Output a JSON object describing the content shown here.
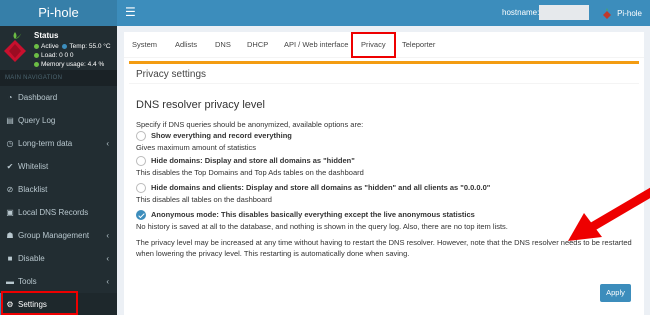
{
  "app": {
    "title": "Pi-hole",
    "menu_icon": "hamburger-icon"
  },
  "topbar": {
    "hostname_label": "hostname:",
    "user_label": "Pi-hole"
  },
  "sidebar": {
    "status": {
      "title": "Status",
      "active": "Active",
      "temp": "Temp: 55.0 °C",
      "load": "Load:  0  0  0",
      "memory": "Memory usage:  4.4 %"
    },
    "nav_header": "MAIN NAVIGATION",
    "items": [
      {
        "label": "Dashboard",
        "icon": "dashboard-icon",
        "glyph": "◔"
      },
      {
        "label": "Query Log",
        "icon": "file-icon",
        "glyph": "▤"
      },
      {
        "label": "Long-term data",
        "icon": "history-icon",
        "glyph": "◷",
        "chevron": "‹"
      },
      {
        "label": "Whitelist",
        "icon": "check-circle-icon",
        "glyph": "✔"
      },
      {
        "label": "Blacklist",
        "icon": "ban-icon",
        "glyph": "⊘"
      },
      {
        "label": "Local DNS Records",
        "icon": "address-book-icon",
        "glyph": "▣"
      },
      {
        "label": "Group Management",
        "icon": "users-icon",
        "glyph": "☗",
        "chevron": "‹"
      },
      {
        "label": "Disable",
        "icon": "stop-icon",
        "glyph": "■",
        "chevron": "‹"
      },
      {
        "label": "Tools",
        "icon": "folder-icon",
        "glyph": "▬",
        "chevron": "‹"
      },
      {
        "label": "Settings",
        "icon": "gears-icon",
        "glyph": "⚙"
      }
    ]
  },
  "tabs": [
    "System",
    "Adlists",
    "DNS",
    "DHCP",
    "API / Web interface",
    "Privacy",
    "Teleporter"
  ],
  "privacy": {
    "title": "Privacy settings",
    "heading": "DNS resolver privacy level",
    "intro": "Specify if DNS queries should be anonymized, available options are:",
    "options": [
      {
        "label": "Show everything and record everything",
        "desc": "Gives maximum amount of statistics"
      },
      {
        "label": "Hide domains: Display and store all domains as \"hidden\"",
        "desc": "This disables the Top Domains and Top Ads tables on the dashboard"
      },
      {
        "label": "Hide domains and clients: Display and store all domains as \"hidden\" and all clients as \"0.0.0.0\"",
        "desc": "This disables all tables on the dashboard"
      },
      {
        "label": "Anonymous mode: This disables basically everything except the live anonymous statistics",
        "desc": "No history is saved at all to the database, and nothing is shown in the query log. Also, there are no top item lists."
      }
    ],
    "selected_index": 3,
    "note": "The privacy level may be increased at any time without having to restart the DNS resolver. However, note that the DNS resolver needs to be restarted when lowering the privacy level. This restarting is automatically done when saving.",
    "apply_label": "Apply"
  },
  "colors": {
    "primary": "#3c8dbc",
    "sidebar": "#222d32",
    "highlight": "#ee0000",
    "box_accent": "#f39c12"
  }
}
